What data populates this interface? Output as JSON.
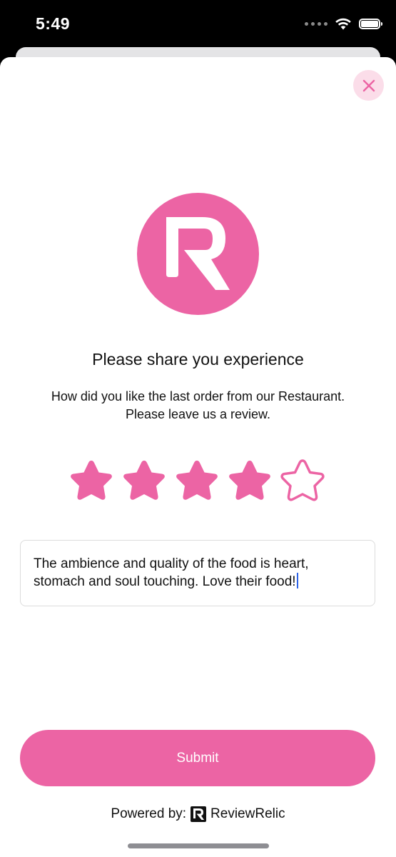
{
  "status_bar": {
    "time": "5:49",
    "icons": [
      "signal-dots-icon",
      "wifi-icon",
      "battery-icon"
    ]
  },
  "header": {
    "close_icon": "close-icon"
  },
  "logo": {
    "icon": "review-relic-logo-icon",
    "color": "#EC64A4"
  },
  "content": {
    "title": "Please share you experience",
    "subtitle_line1": "How did you like the last order from our Restaurant.",
    "subtitle_line2": "Please leave us a review."
  },
  "rating": {
    "value": 4,
    "max": 5
  },
  "review": {
    "text": "The ambience and quality of the food is heart, stomach and soul touching. Love their food!"
  },
  "actions": {
    "submit_label": "Submit"
  },
  "footer": {
    "powered_by_label": "Powered by:",
    "brand_name": "ReviewRelic",
    "brand_icon": "review-relic-mark-icon"
  },
  "colors": {
    "accent": "#EC64A4",
    "close_button_bg": "#FBDDE9"
  }
}
